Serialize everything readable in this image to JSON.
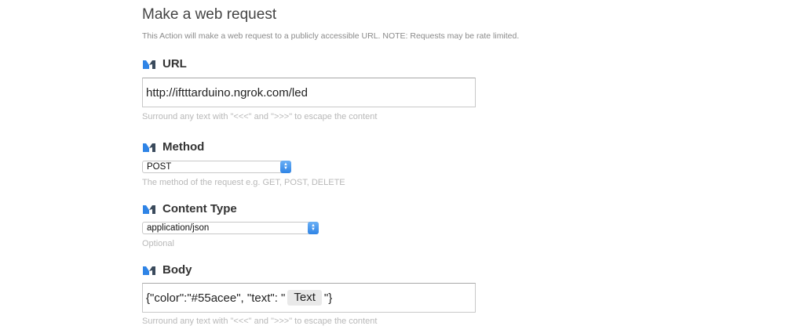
{
  "header": {
    "title": "Make a web request",
    "description": "This Action will make a web request to a publicly accessible URL. NOTE: Requests may be rate limited."
  },
  "fields": {
    "url": {
      "label": "URL",
      "value": "http://iftttarduino.ngrok.com/led",
      "hint": "Surround any text with \"<<<\" and \">>>\" to escape the content"
    },
    "method": {
      "label": "Method",
      "selected": "POST",
      "hint": "The method of the request e.g. GET, POST, DELETE"
    },
    "content_type": {
      "label": "Content Type",
      "selected": "application/json",
      "hint": "Optional"
    },
    "body": {
      "label": "Body",
      "value_prefix": "{\"color\":\"#55acee\", \"text\": \"",
      "ingredient": "Text",
      "value_suffix": "\"}",
      "hint": "Surround any text with \"<<<\" and \">>>\" to escape the content"
    }
  },
  "icons": {
    "field_icon": "maker-m-logo-icon",
    "select_icon": "select-stepper-icon"
  },
  "colors": {
    "logo_blue": "#2f84e6",
    "logo_dark": "#3a4a5c",
    "stepper_blue": "#2f84e6"
  }
}
